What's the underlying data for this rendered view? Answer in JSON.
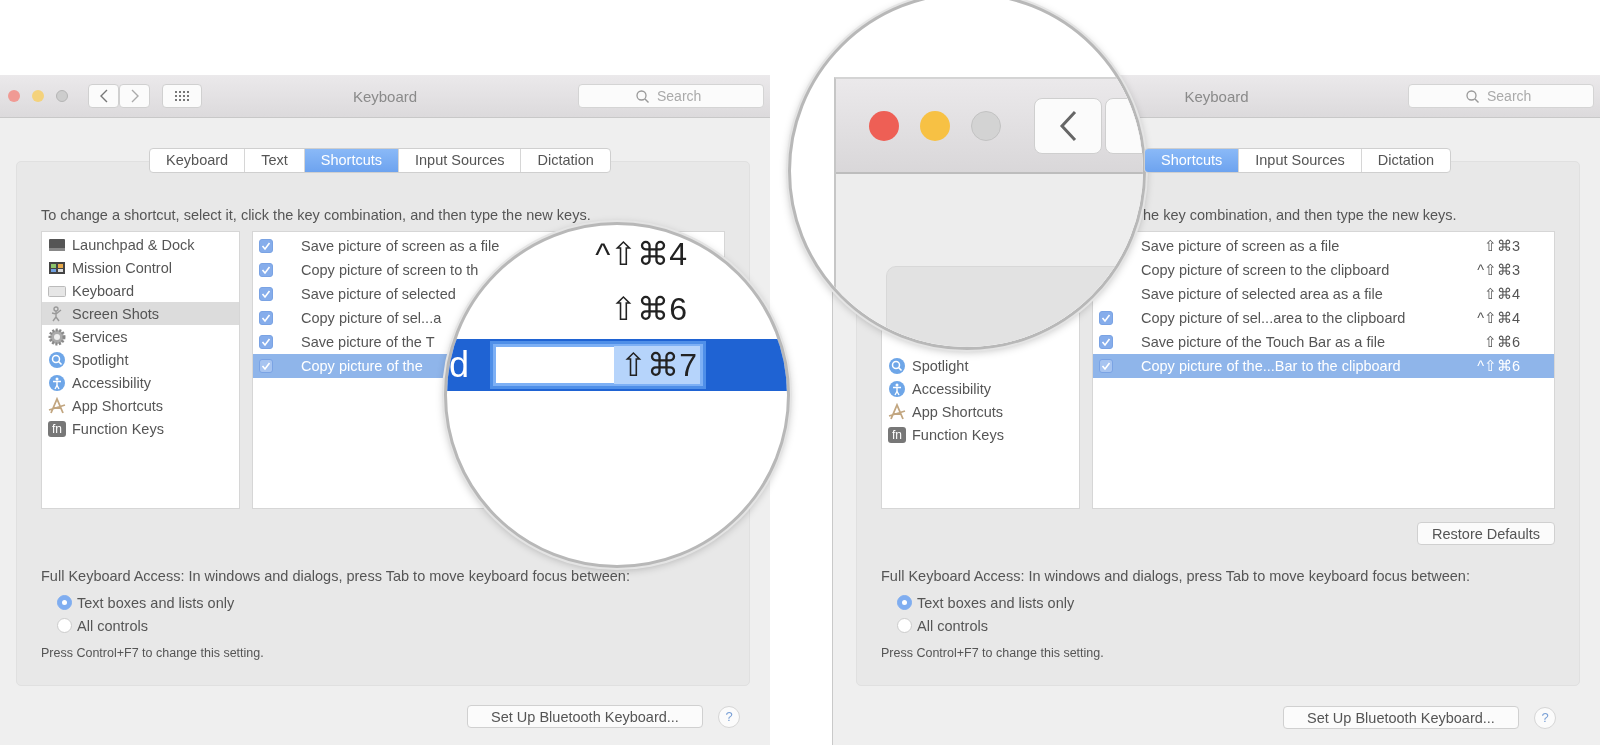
{
  "panels": [
    {
      "window_title": "Keyboard",
      "nav_controls": true,
      "search": {
        "placeholder": "Search"
      },
      "tabs": [
        {
          "label": "Keyboard",
          "selected": false
        },
        {
          "label": "Text",
          "selected": false
        },
        {
          "label": "Shortcuts",
          "selected": true
        },
        {
          "label": "Input Sources",
          "selected": false
        },
        {
          "label": "Dictation",
          "selected": false
        }
      ],
      "instruction": "To change a shortcut, select it, click the key combination, and then type the new keys.",
      "categories": [
        {
          "label": "Launchpad & Dock",
          "kind": "display",
          "selected": false
        },
        {
          "label": "Mission Control",
          "kind": "windows",
          "selected": false
        },
        {
          "label": "Keyboard",
          "kind": "keyboard",
          "selected": false
        },
        {
          "label": "Screen Shots",
          "kind": "figure",
          "selected": true
        },
        {
          "label": "Services",
          "kind": "gear",
          "selected": false
        },
        {
          "label": "Spotlight",
          "kind": "search",
          "selected": false
        },
        {
          "label": "Accessibility",
          "kind": "accessibility",
          "selected": false
        },
        {
          "label": "App Shortcuts",
          "kind": "letter",
          "selected": false
        },
        {
          "label": "Function Keys",
          "kind": "badge",
          "badge": "fn",
          "selected": false
        }
      ],
      "shortcuts": [
        {
          "label": "Save picture of screen as a file",
          "checked": true,
          "selected": false
        },
        {
          "label": "Copy picture of screen to th",
          "checked": true,
          "selected": false
        },
        {
          "label": "Save picture of selected",
          "checked": true,
          "selected": false
        },
        {
          "label": "Copy picture of sel...a",
          "checked": true,
          "selected": false
        },
        {
          "label": "Save picture of the T",
          "checked": true,
          "selected": false
        },
        {
          "label": "Copy picture of the",
          "checked": true,
          "selected": true
        }
      ],
      "full_keyboard_access": {
        "label": "Full Keyboard Access: In windows and dialogs, press Tab to move keyboard focus between:",
        "options": [
          {
            "label": "Text boxes and lists only",
            "selected": true
          },
          {
            "label": "All controls",
            "selected": false
          }
        ],
        "note": "Press Control+F7 to change this setting."
      },
      "setup_button": "Set Up Bluetooth Keyboard...",
      "help_button": "?"
    },
    {
      "window_title": "Keyboard",
      "search": {
        "placeholder": "Search"
      },
      "tabs": [
        {
          "label": "Shortcuts",
          "selected": true
        },
        {
          "label": "Input Sources",
          "selected": false
        },
        {
          "label": "Dictation",
          "selected": false
        }
      ],
      "instruction": "he key combination, and then type the new keys.",
      "categories": [
        {
          "label": "Spotlight",
          "kind": "search",
          "selected": false
        },
        {
          "label": "Accessibility",
          "kind": "accessibility",
          "selected": false
        },
        {
          "label": "App Shortcuts",
          "kind": "letter",
          "selected": false
        },
        {
          "label": "Function Keys",
          "kind": "badge",
          "badge": "fn",
          "selected": false
        }
      ],
      "shortcuts": [
        {
          "label": "Save picture of screen as a file",
          "keys": "⇧⌘3",
          "selected": false
        },
        {
          "label": "Copy picture of screen to the clipboard",
          "keys": "^⇧⌘3",
          "selected": false
        },
        {
          "label": "Save picture of selected area as a file",
          "keys": "⇧⌘4",
          "selected": false
        },
        {
          "label": "Copy picture of sel...area to the clipboard",
          "keys": "^⇧⌘4",
          "checked": true,
          "selected": false
        },
        {
          "label": "Save picture of the Touch Bar as a file",
          "keys": "⇧⌘6",
          "checked": true,
          "selected": false
        },
        {
          "label": "Copy picture of the...Bar to the clipboard",
          "keys": "^⇧⌘6",
          "checked": true,
          "selected": true
        }
      ],
      "restore_defaults": "Restore Defaults",
      "full_keyboard_access": {
        "label": "Full Keyboard Access: In windows and dialogs, press Tab to move keyboard focus between:",
        "options": [
          {
            "label": "Text boxes and lists only",
            "selected": true
          },
          {
            "label": "All controls",
            "selected": false
          }
        ],
        "note": "Press Control+F7 to change this setting."
      },
      "setup_button": "Set Up Bluetooth Keyboard...",
      "help_button": "?"
    }
  ],
  "magnifiers": [
    {
      "kind": "shortcut_field",
      "keys": [
        "^⇧⌘4",
        "⇧⌘6"
      ],
      "row_text": "d",
      "field_value": "⇧⌘7"
    },
    {
      "kind": "title_bar"
    }
  ]
}
